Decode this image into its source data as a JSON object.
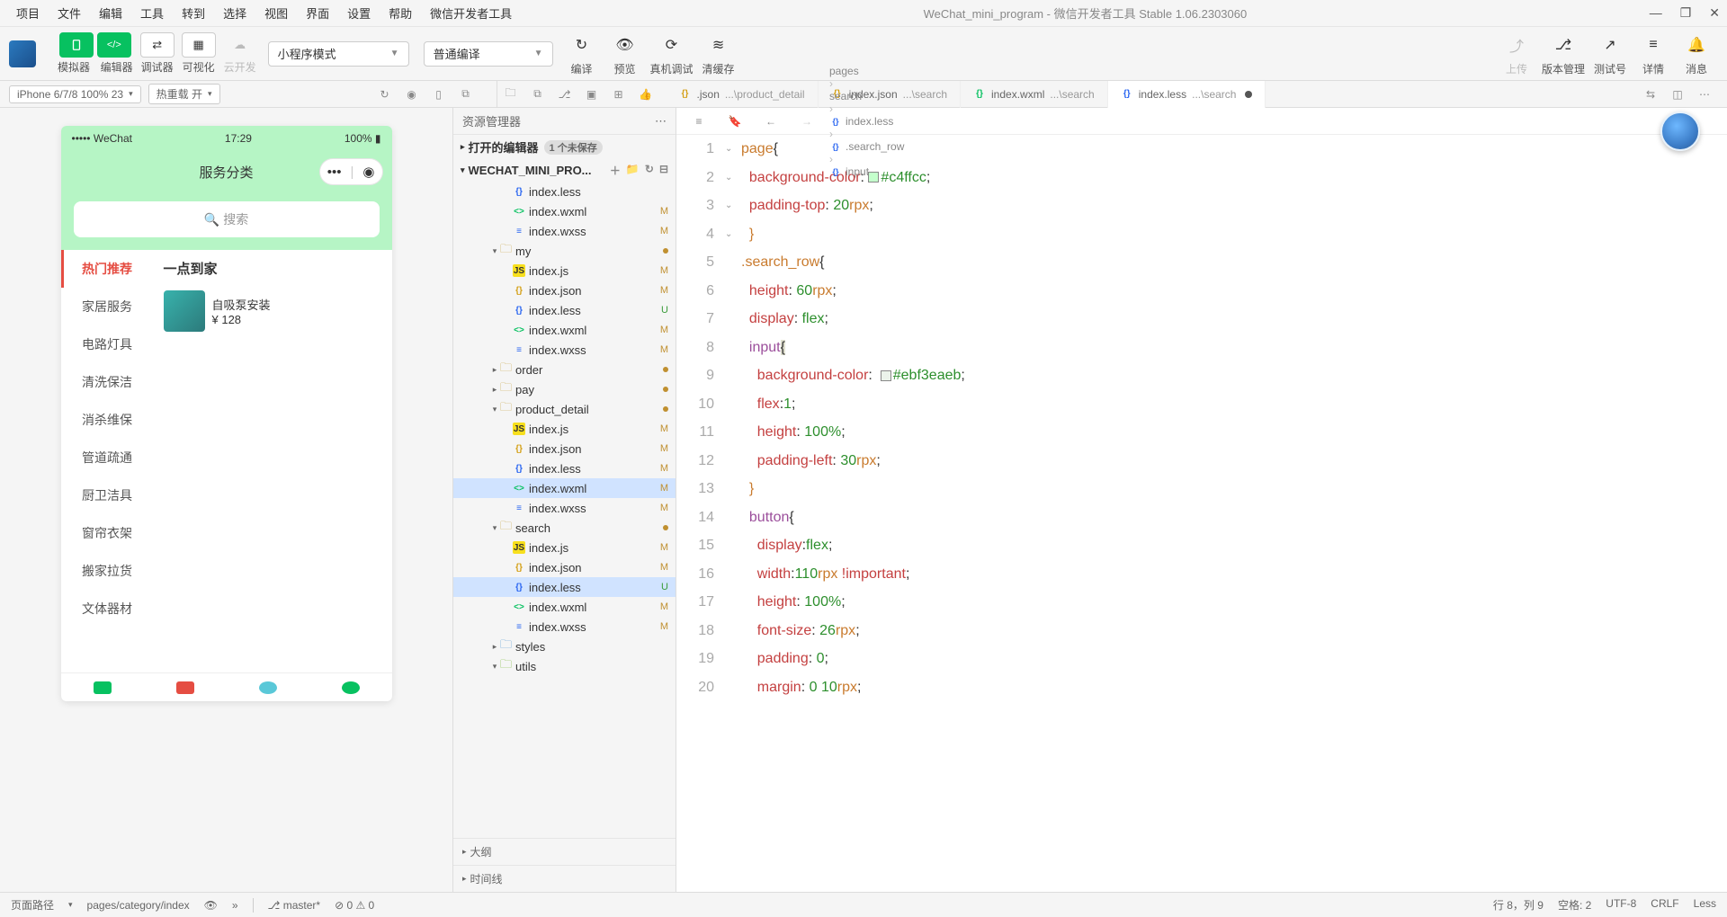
{
  "menu": [
    "项目",
    "文件",
    "编辑",
    "工具",
    "转到",
    "选择",
    "视图",
    "界面",
    "设置",
    "帮助",
    "微信开发者工具"
  ],
  "title": "WeChat_mini_program - 微信开发者工具 Stable 1.06.2303060",
  "toolbar": {
    "simulator": "模拟器",
    "editor": "编辑器",
    "debugger": "调试器",
    "visual": "可视化",
    "cloud": "云开发",
    "upload": "上传",
    "version": "版本管理",
    "test": "测试号",
    "detail": "详情",
    "msg": "消息",
    "compile": "编译",
    "preview": "预览",
    "real": "真机调试",
    "cache": "清缓存",
    "mode": "小程序模式",
    "compileMode": "普通编译"
  },
  "secbar": {
    "device": "iPhone 6/7/8 100% 23",
    "hotreload": "热重载 开"
  },
  "tabs": [
    {
      "icon": "json",
      "name": ".json",
      "path": "...\\product_detail",
      "active": false
    },
    {
      "icon": "json",
      "name": "index.json",
      "path": "...\\search",
      "active": false
    },
    {
      "icon": "wxml",
      "name": "index.wxml",
      "path": "...\\search",
      "active": false
    },
    {
      "icon": "less",
      "name": "index.less",
      "path": "...\\search",
      "active": true,
      "dirty": true
    }
  ],
  "simulator": {
    "carrier": "••••• WeChat",
    "time": "17:29",
    "battery": "100%",
    "title": "服务分类",
    "searchPlaceholder": "搜索",
    "side": [
      "热门推荐",
      "家居服务",
      "电路灯具",
      "清洗保洁",
      "消杀维保",
      "管道疏通",
      "厨卫洁具",
      "窗帘衣架",
      "搬家拉货",
      "文体器材"
    ],
    "section": "一点到家",
    "product": {
      "name": "自吸泵安装",
      "price": "¥ 128"
    }
  },
  "explorer": {
    "title": "资源管理器",
    "moreAria": "...",
    "openEditors": "打开的编辑器",
    "unsaved": "1 个未保存",
    "project": "WECHAT_MINI_PRO...",
    "outline": "大纲",
    "timeline": "时间线",
    "tree": [
      {
        "d": 3,
        "t": "file",
        "ico": "less",
        "n": "index.less",
        "s": ""
      },
      {
        "d": 3,
        "t": "file",
        "ico": "wxml",
        "n": "index.wxml",
        "s": "M"
      },
      {
        "d": 3,
        "t": "file",
        "ico": "wxss",
        "n": "index.wxss",
        "s": "M"
      },
      {
        "d": 2,
        "t": "folder",
        "open": true,
        "n": "my",
        "s": "dot"
      },
      {
        "d": 3,
        "t": "file",
        "ico": "js",
        "n": "index.js",
        "s": "M"
      },
      {
        "d": 3,
        "t": "file",
        "ico": "json",
        "n": "index.json",
        "s": "M"
      },
      {
        "d": 3,
        "t": "file",
        "ico": "less",
        "n": "index.less",
        "s": "U"
      },
      {
        "d": 3,
        "t": "file",
        "ico": "wxml",
        "n": "index.wxml",
        "s": "M"
      },
      {
        "d": 3,
        "t": "file",
        "ico": "wxss",
        "n": "index.wxss",
        "s": "M"
      },
      {
        "d": 2,
        "t": "folder",
        "open": false,
        "n": "order",
        "s": "dot"
      },
      {
        "d": 2,
        "t": "folder",
        "open": false,
        "n": "pay",
        "s": "dot"
      },
      {
        "d": 2,
        "t": "folder",
        "open": true,
        "n": "product_detail",
        "s": "dot"
      },
      {
        "d": 3,
        "t": "file",
        "ico": "js",
        "n": "index.js",
        "s": "M"
      },
      {
        "d": 3,
        "t": "file",
        "ico": "json",
        "n": "index.json",
        "s": "M"
      },
      {
        "d": 3,
        "t": "file",
        "ico": "less",
        "n": "index.less",
        "s": "M"
      },
      {
        "d": 3,
        "t": "file",
        "ico": "wxml",
        "n": "index.wxml",
        "s": "M",
        "sel": true
      },
      {
        "d": 3,
        "t": "file",
        "ico": "wxss",
        "n": "index.wxss",
        "s": "M"
      },
      {
        "d": 2,
        "t": "folder",
        "open": true,
        "n": "search",
        "s": "dot"
      },
      {
        "d": 3,
        "t": "file",
        "ico": "js",
        "n": "index.js",
        "s": "M"
      },
      {
        "d": 3,
        "t": "file",
        "ico": "json",
        "n": "index.json",
        "s": "M"
      },
      {
        "d": 3,
        "t": "file",
        "ico": "less",
        "n": "index.less",
        "s": "U",
        "sel2": true
      },
      {
        "d": 3,
        "t": "file",
        "ico": "wxml",
        "n": "index.wxml",
        "s": "M"
      },
      {
        "d": 3,
        "t": "file",
        "ico": "wxss",
        "n": "index.wxss",
        "s": "M"
      },
      {
        "d": 2,
        "t": "folder",
        "open": false,
        "n": "styles",
        "s": "",
        "icoColor": "#5a9bd5"
      },
      {
        "d": 2,
        "t": "folder",
        "open": true,
        "n": "utils",
        "s": "",
        "icoColor": "#7fba3a"
      }
    ]
  },
  "breadcrumbs": [
    "pages",
    "search",
    "index.less",
    ".search_row",
    "input"
  ],
  "code": [
    {
      "n": 1,
      "fold": "v",
      "h": "<span class='tok-sel'>page</span><span class='tok-punc'>{</span>"
    },
    {
      "n": 2,
      "h": "  <span class='tok-prop'>background-color</span><span class='tok-punc'>:</span> <span class='color-swatch' style='background:#c4ffcc'></span><span class='tok-val'>#c4ffcc</span><span class='tok-punc'>;</span>"
    },
    {
      "n": 3,
      "h": "  <span class='tok-prop'>padding-top</span><span class='tok-punc'>:</span> <span class='tok-val'>20</span><span class='tok-sel'>rpx</span><span class='tok-punc'>;</span>"
    },
    {
      "n": 4,
      "h": "  <span class='tok-punc' style='color:#c97b2e'>}</span>"
    },
    {
      "n": 5,
      "fold": "v",
      "h": "<span class='tok-sel'>.search_row</span><span class='tok-punc'>{</span>"
    },
    {
      "n": 6,
      "h": "  <span class='tok-prop'>height</span><span class='tok-punc'>:</span> <span class='tok-val'>60</span><span class='tok-sel'>rpx</span><span class='tok-punc'>;</span>"
    },
    {
      "n": 7,
      "h": "  <span class='tok-prop'>display</span><span class='tok-punc'>:</span> <span class='tok-val'>flex</span><span class='tok-punc'>;</span>"
    },
    {
      "n": 8,
      "fold": "v",
      "hl": true,
      "h": "  <span class='tok-tag'>input</span><span class='tok-punc' style='background:#e0e0d0'>{</span>"
    },
    {
      "n": 9,
      "h": "    <span class='tok-prop'>background-color</span><span class='tok-punc'>:</span>  <span class='color-swatch' style='background:#ebf3ea'></span><span class='tok-val'>#ebf3eaeb</span><span class='tok-punc'>;</span>"
    },
    {
      "n": 10,
      "h": "    <span class='tok-prop'>flex</span><span class='tok-punc'>:</span><span class='tok-val'>1</span><span class='tok-punc'>;</span>"
    },
    {
      "n": 11,
      "h": "    <span class='tok-prop'>height</span><span class='tok-punc'>:</span> <span class='tok-val'>100%</span><span class='tok-punc'>;</span>"
    },
    {
      "n": 12,
      "h": "    <span class='tok-prop'>padding-left</span><span class='tok-punc'>:</span> <span class='tok-val'>30</span><span class='tok-sel'>rpx</span><span class='tok-punc'>;</span>"
    },
    {
      "n": 13,
      "h": "  <span class='tok-punc' style='color:#c97b2e'>}</span>"
    },
    {
      "n": 14,
      "fold": "v",
      "h": "  <span class='tok-tag'>button</span><span class='tok-punc'>{</span>"
    },
    {
      "n": 15,
      "h": "    <span class='tok-prop'>display</span><span class='tok-punc'>:</span><span class='tok-val'>flex</span><span class='tok-punc'>;</span>"
    },
    {
      "n": 16,
      "h": "    <span class='tok-prop'>width</span><span class='tok-punc'>:</span><span class='tok-val'>110</span><span class='tok-sel'>rpx</span> <span class='tok-prop'>!important</span><span class='tok-punc'>;</span>"
    },
    {
      "n": 17,
      "h": "    <span class='tok-prop'>height</span><span class='tok-punc'>:</span> <span class='tok-val'>100%</span><span class='tok-punc'>;</span>"
    },
    {
      "n": 18,
      "h": "    <span class='tok-prop'>font-size</span><span class='tok-punc'>:</span> <span class='tok-val'>26</span><span class='tok-sel'>rpx</span><span class='tok-punc'>;</span>"
    },
    {
      "n": 19,
      "h": "    <span class='tok-prop'>padding</span><span class='tok-punc'>:</span> <span class='tok-val'>0</span><span class='tok-punc'>;</span>"
    },
    {
      "n": 20,
      "h": "    <span class='tok-prop'>margin</span><span class='tok-punc'>:</span> <span class='tok-val'>0 10</span><span class='tok-sel'>rpx</span><span class='tok-punc'>;</span>"
    }
  ],
  "status": {
    "pagePath": "页面路径",
    "pathValue": "pages/category/index",
    "branch": "master*",
    "errWarn": "⊘ 0 ⚠ 0",
    "pos": "行 8，列 9",
    "spaces": "空格: 2",
    "enc": "UTF-8",
    "eol": "CRLF",
    "lang": "Less"
  }
}
